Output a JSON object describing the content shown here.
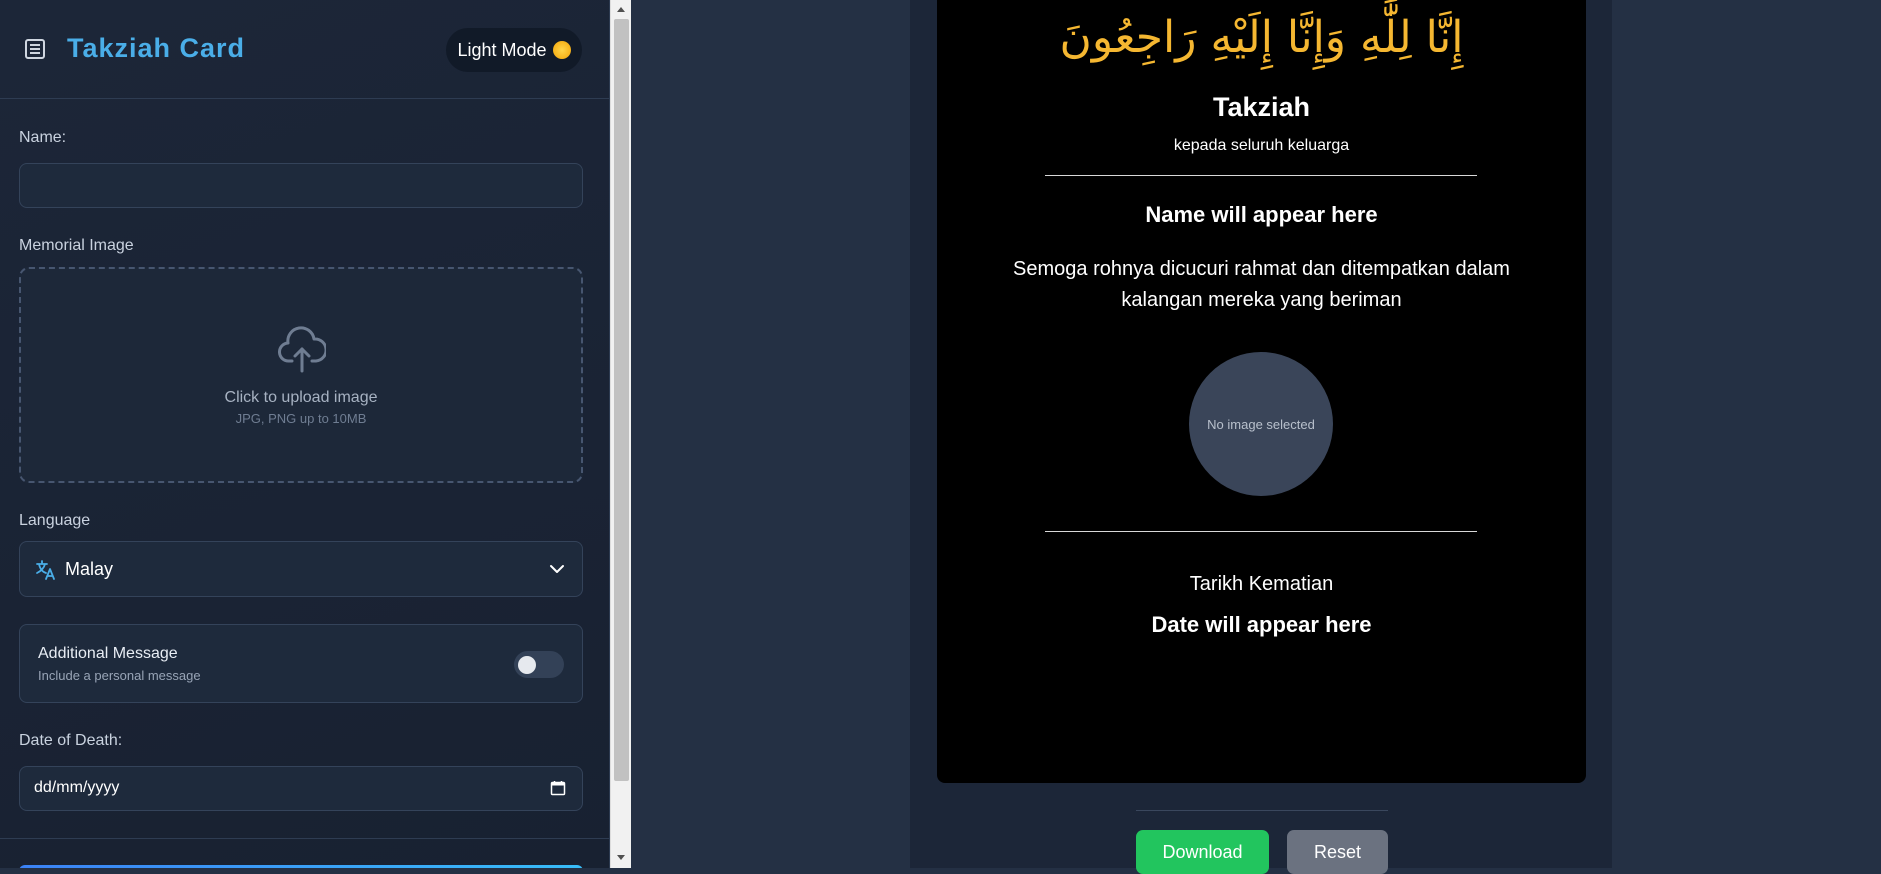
{
  "sidebar": {
    "brand_title": "Takziah Card",
    "brand_icon": "scroll-icon",
    "mode_toggle_label": "Light Mode",
    "name_label": "Name:",
    "name_value": "",
    "image_label": "Memorial Image",
    "upload_title": "Click to upload image",
    "upload_hint": "JPG, PNG up to 10MB",
    "language_label": "Language",
    "language_value": "Malay",
    "additional_title": "Additional Message",
    "additional_sub": "Include a personal message",
    "additional_enabled": false,
    "date_label": "Date of Death:",
    "date_value": "dd/mm/yyyy"
  },
  "card": {
    "arabic": "إِنَّا لِلَّٰهِ وَإِنَّا إِلَيْهِ رَاجِعُونَ",
    "title": "Takziah",
    "subtitle": "kepada seluruh keluarga",
    "name_placeholder": "Name will appear here",
    "message": "Semoga rohnya dicucuri rahmat dan ditempatkan dalam kalangan mereka yang beriman",
    "image_placeholder": "No image selected",
    "date_label": "Tarikh Kematian",
    "date_placeholder": "Date will appear here"
  },
  "actions": {
    "download_label": "Download",
    "reset_label": "Reset"
  },
  "colors": {
    "accent": "#4aaee8",
    "arabic_gold": "#f5b731",
    "download_green": "#22c55e",
    "reset_gray": "#6b7280"
  }
}
